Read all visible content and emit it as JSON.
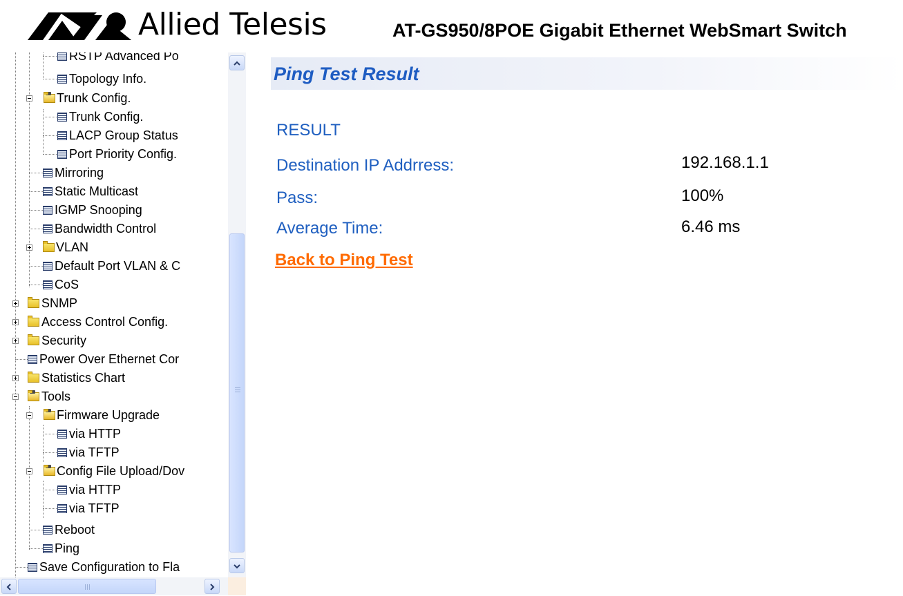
{
  "header": {
    "brand_name": "Allied Telesis",
    "product_name": "AT-GS950/8POE Gigabit Ethernet WebSmart Switch"
  },
  "colors": {
    "title_blue": "#1e5cc2",
    "label_blue": "#1f5fc0",
    "link_orange": "#ff6a00",
    "title_bar_bg": "#e6ebf6"
  },
  "nav": {
    "items": [
      {
        "label": "RSTP Advanced Po",
        "icon": "document-icon"
      },
      {
        "label": "Topology Info.",
        "icon": "document-icon"
      },
      {
        "label": "Trunk Config.",
        "icon": "folder-open-icon"
      },
      {
        "label": "Trunk Config.",
        "icon": "document-icon"
      },
      {
        "label": "LACP Group Status",
        "icon": "document-icon"
      },
      {
        "label": "Port Priority Config.",
        "icon": "document-icon"
      },
      {
        "label": "Mirroring",
        "icon": "document-icon"
      },
      {
        "label": "Static Multicast",
        "icon": "document-icon"
      },
      {
        "label": "IGMP Snooping",
        "icon": "document-icon"
      },
      {
        "label": "Bandwidth Control",
        "icon": "document-icon"
      },
      {
        "label": "VLAN",
        "icon": "folder-icon"
      },
      {
        "label": "Default Port VLAN & C",
        "icon": "document-icon"
      },
      {
        "label": "CoS",
        "icon": "document-icon"
      },
      {
        "label": "SNMP",
        "icon": "folder-icon"
      },
      {
        "label": "Access Control Config.",
        "icon": "folder-icon"
      },
      {
        "label": "Security",
        "icon": "folder-icon"
      },
      {
        "label": "Power Over Ethernet Cor",
        "icon": "document-icon"
      },
      {
        "label": "Statistics Chart",
        "icon": "folder-icon"
      },
      {
        "label": "Tools",
        "icon": "folder-open-icon"
      },
      {
        "label": "Firmware Upgrade",
        "icon": "folder-open-icon"
      },
      {
        "label": "via HTTP",
        "icon": "document-icon"
      },
      {
        "label": "via TFTP",
        "icon": "document-icon"
      },
      {
        "label": "Config File Upload/Dov",
        "icon": "folder-open-icon"
      },
      {
        "label": "via HTTP",
        "icon": "document-icon"
      },
      {
        "label": "via TFTP",
        "icon": "document-icon"
      },
      {
        "label": "Reboot",
        "icon": "document-icon"
      },
      {
        "label": "Ping",
        "icon": "document-icon"
      },
      {
        "label": "Save Configuration to Fla",
        "icon": "document-icon"
      }
    ]
  },
  "main": {
    "title": "Ping Test Result",
    "result_heading": "RESULT",
    "rows": [
      {
        "label": "Destination IP Addrress:",
        "value": "192.168.1.1"
      },
      {
        "label": "Pass:",
        "value": "100%"
      },
      {
        "label": "Average Time:",
        "value": "6.46 ms"
      }
    ],
    "back_link": "Back to Ping Test"
  }
}
